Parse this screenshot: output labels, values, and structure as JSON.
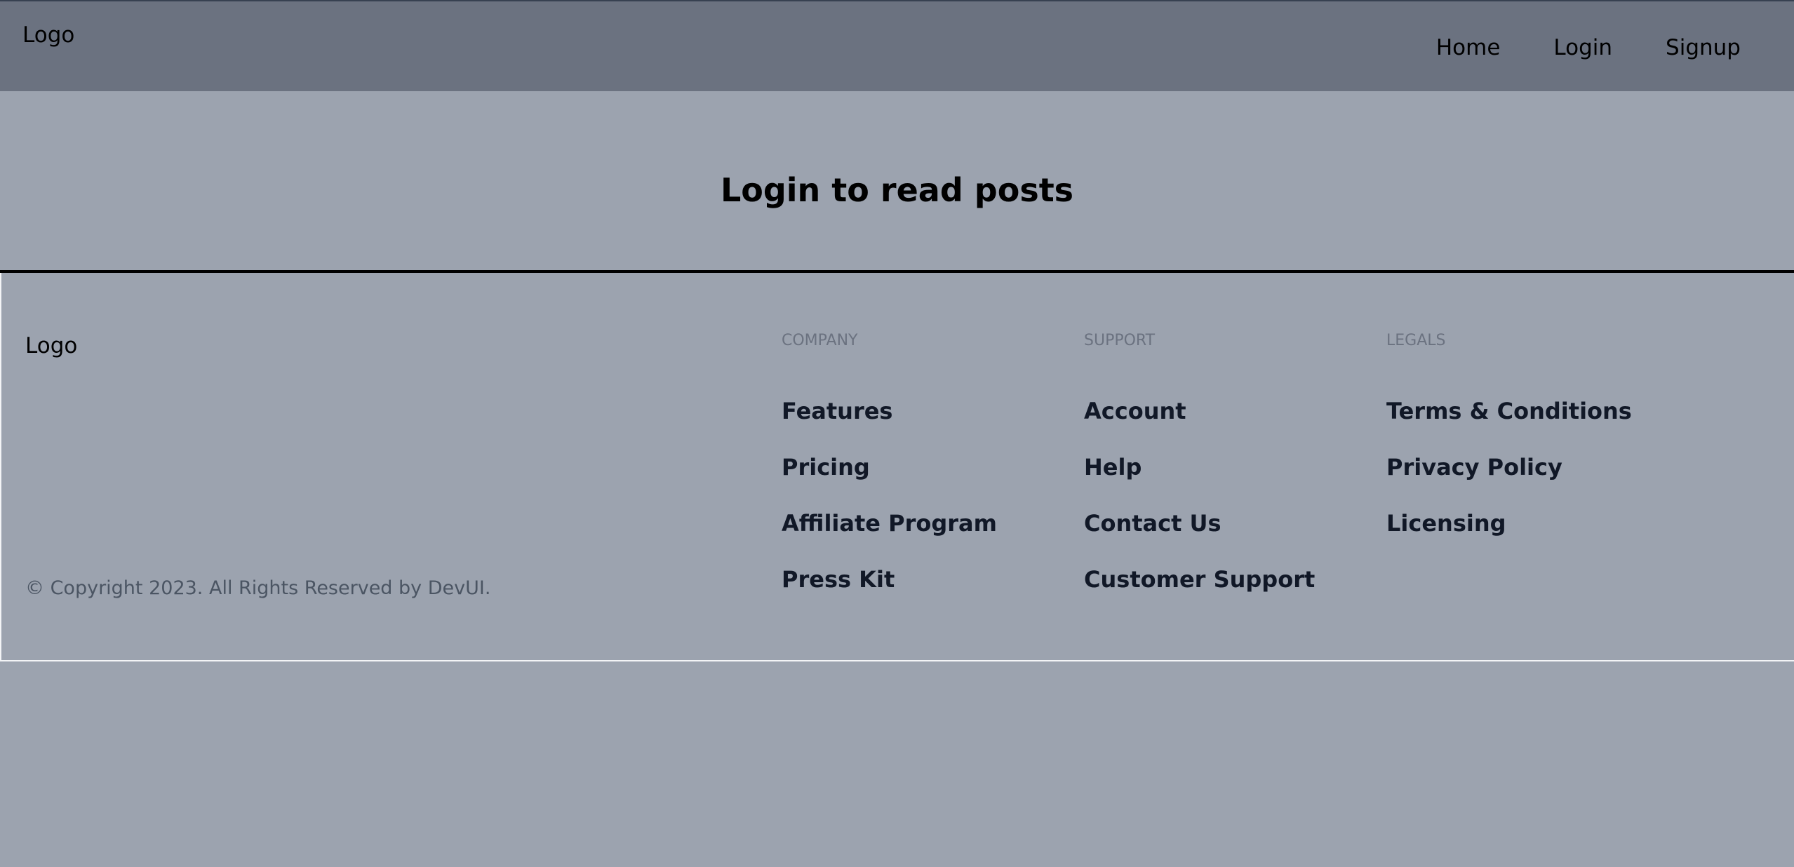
{
  "nav": {
    "logo": "Logo",
    "links": [
      "Home",
      "Login",
      "Signup"
    ]
  },
  "hero": {
    "title": "Login to read posts"
  },
  "footer": {
    "logo": "Logo",
    "copyright": "© Copyright 2023. All Rights Reserved by DevUI.",
    "columns": [
      {
        "heading": "COMPANY",
        "links": [
          "Features",
          "Pricing",
          "Affiliate Program",
          "Press Kit"
        ]
      },
      {
        "heading": "SUPPORT",
        "links": [
          "Account",
          "Help",
          "Contact Us",
          "Customer Support"
        ]
      },
      {
        "heading": "LEGALS",
        "links": [
          "Terms & Conditions",
          "Privacy Policy",
          "Licensing"
        ]
      }
    ]
  }
}
